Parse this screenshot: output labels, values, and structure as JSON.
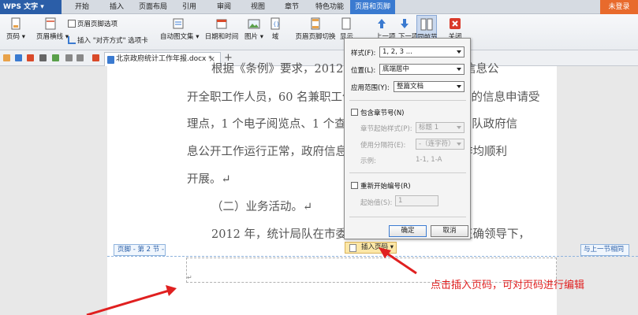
{
  "app": {
    "logo": "WPS 文字",
    "login": "未登录"
  },
  "menu": [
    "开始",
    "插入",
    "页面布局",
    "引用",
    "审阅",
    "视图",
    "章节",
    "特色功能",
    "页眉和页脚"
  ],
  "ribbon": {
    "page_number": "页码",
    "header_line": "页眉横线",
    "header_footer_options": "页眉页脚选项",
    "insert_align_tab": "插入 \"对齐方式\" 选项卡",
    "auto_graphics": "自动图文集",
    "date_time": "日期和时间",
    "picture": "图片",
    "field": "域",
    "switch_header_footer": "页眉页脚切换",
    "show": "显示",
    "prev": "上一项",
    "next": "下一项",
    "same_as_prev": "同前节",
    "close": "关闭"
  },
  "doc_tab": {
    "title": "北京政府统计工作年报.docx *"
  },
  "document": {
    "lines": [
      "根据《条例》要求，2012 年本局设立了 1 名政府信息公",
      "开全职工作人员，60 名兼职工作人员，设立了 1 个部门的信息申请受",
      "理点，1 个电子阅览点、1 个查阅点，确保了北京统计局队政府信",
      "息公开工作运行正常，政府信息公开申请受理和答复工作均顺利",
      "开展。↵",
      "（二）业务活动。↵",
      "2012 年，统计局队在市委市政府和国家统计局的正确领导下，"
    ],
    "footer_label": "页脚 - 第 2 节 -",
    "same_as_prev": "与上一节相同",
    "insert_page_number": "插入页码",
    "paragraph_mark": "↵"
  },
  "dialog": {
    "style_label": "样式(F):",
    "style_value": "1, 2, 3 ...",
    "position_label": "位置(L):",
    "position_value": "底端居中",
    "apply_label": "应用范围(Y):",
    "apply_value": "整篇文档",
    "include_chapter": "包含章节号(N)",
    "chapter_style_label": "章节起始样式(P):",
    "chapter_style_value": "标题 1",
    "separator_label": "使用分隔符(E):",
    "separator_value": "-（连字符）",
    "example_label": "示例:",
    "example_value": "1-1, 1-A",
    "restart_numbering": "重新开始编号(R)",
    "start_value_label": "起始值(S):",
    "start_value": "1",
    "ok": "确定",
    "cancel": "取消"
  },
  "annotation": "点击插入页码，可对页码进行编辑",
  "colors": {
    "accent": "#3a7ad0",
    "logo": "#2b5ea8",
    "login": "#e86a2c",
    "arrow": "#e02020"
  }
}
